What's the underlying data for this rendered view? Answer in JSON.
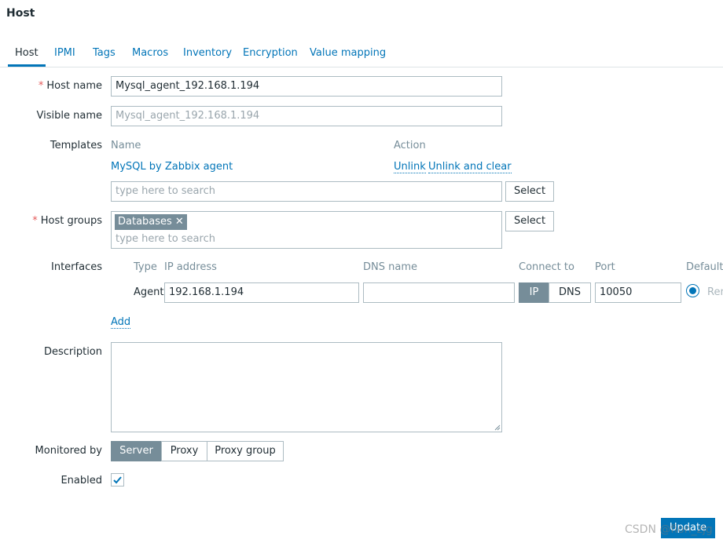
{
  "page": {
    "title": "Host"
  },
  "tabs": [
    {
      "label": "Host",
      "active": true
    },
    {
      "label": "IPMI"
    },
    {
      "label": "Tags"
    },
    {
      "label": "Macros"
    },
    {
      "label": "Inventory"
    },
    {
      "label": "Encryption"
    },
    {
      "label": "Value mapping"
    }
  ],
  "form": {
    "host_name": {
      "label": "Host name",
      "required_mark": "*",
      "value": "Mysql_agent_192.168.1.194"
    },
    "visible_name": {
      "label": "Visible name",
      "placeholder": "Mysql_agent_192.168.1.194"
    },
    "templates": {
      "label": "Templates",
      "col_name": "Name",
      "col_action": "Action",
      "items": [
        {
          "name": "MySQL by Zabbix agent",
          "unlink": "Unlink",
          "unlink_clear": "Unlink and clear"
        }
      ],
      "search_placeholder": "type here to search",
      "select_label": "Select"
    },
    "host_groups": {
      "label": "Host groups",
      "required_mark": "*",
      "chips": [
        "Databases"
      ],
      "chip_remove": "✕",
      "search_placeholder": "type here to search",
      "select_label": "Select"
    },
    "interfaces": {
      "label": "Interfaces",
      "headers": {
        "type": "Type",
        "ip": "IP address",
        "dns": "DNS name",
        "connect": "Connect to",
        "port": "Port",
        "default": "Default"
      },
      "rows": [
        {
          "type": "Agent",
          "ip": "192.168.1.194",
          "dns": "",
          "connect_ip": "IP",
          "connect_dns": "DNS",
          "connect_selected": "IP",
          "port": "10050",
          "remove": "Rem"
        }
      ],
      "add_label": "Add"
    },
    "description": {
      "label": "Description",
      "value": ""
    },
    "monitored_by": {
      "label": "Monitored by",
      "options": [
        "Server",
        "Proxy",
        "Proxy group"
      ],
      "selected": "Server"
    },
    "enabled": {
      "label": "Enabled",
      "checked": true
    }
  },
  "actions": {
    "update_label": "Update"
  },
  "watermark": "CSDN @fion_zjg",
  "colors": {
    "accent": "#0275b8",
    "segment_active": "#768d99",
    "required": "#e45959"
  }
}
